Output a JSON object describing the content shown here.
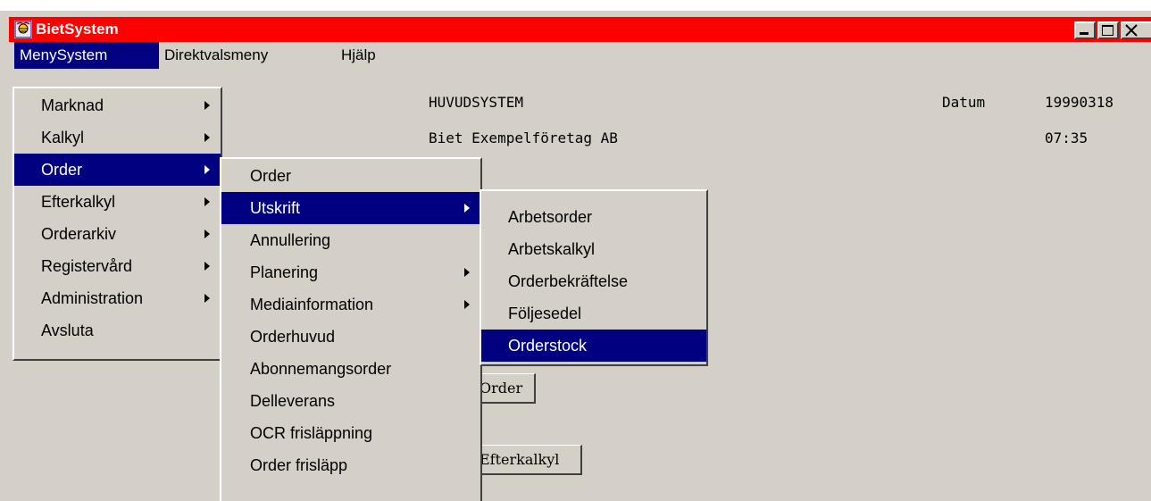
{
  "window": {
    "title": "BietSystem"
  },
  "menubar": {
    "items": [
      "MenySystem",
      "Direktvalsmeny",
      "Hjälp"
    ]
  },
  "content": {
    "system_title": "HUVUDSYSTEM",
    "company": "Biet Exempelföretag AB",
    "date_label": "Datum",
    "date_value": "19990318",
    "time_value": "07:35",
    "buttons": [
      "Order",
      "Efterkalkyl"
    ]
  },
  "menu_main": {
    "items": [
      {
        "label": "Marknad",
        "submenu": true
      },
      {
        "label": "Kalkyl",
        "submenu": true
      },
      {
        "label": "Order",
        "submenu": true,
        "highlighted": true
      },
      {
        "label": "Efterkalkyl",
        "submenu": true
      },
      {
        "label": "Orderarkiv",
        "submenu": true
      },
      {
        "label": "Registervård",
        "submenu": true
      },
      {
        "label": "Administration",
        "submenu": true
      },
      {
        "label": "Avsluta",
        "submenu": false
      }
    ]
  },
  "menu_order": {
    "items": [
      {
        "label": "Order",
        "submenu": false
      },
      {
        "label": "Utskrift",
        "submenu": true,
        "highlighted": true
      },
      {
        "label": "Annullering",
        "submenu": false
      },
      {
        "label": "Planering",
        "submenu": true
      },
      {
        "label": "Mediainformation",
        "submenu": true
      },
      {
        "label": "Orderhuvud",
        "submenu": false
      },
      {
        "label": "Abonnemangsorder",
        "submenu": false
      },
      {
        "label": "Delleverans",
        "submenu": false
      },
      {
        "label": "OCR frisläppning",
        "submenu": false
      },
      {
        "label": "Order frisläpp",
        "submenu": false
      }
    ]
  },
  "menu_utskrift": {
    "items": [
      {
        "label": "Arbetsorder",
        "submenu": false
      },
      {
        "label": "Arbetskalkyl",
        "submenu": false
      },
      {
        "label": "Orderbekräftelse",
        "submenu": false
      },
      {
        "label": "Följesedel",
        "submenu": false
      },
      {
        "label": "Orderstock",
        "submenu": false,
        "highlighted": true
      }
    ]
  },
  "colors": {
    "titlebar": "#ff0000",
    "highlight": "#000080",
    "face": "#d4d0c8"
  }
}
